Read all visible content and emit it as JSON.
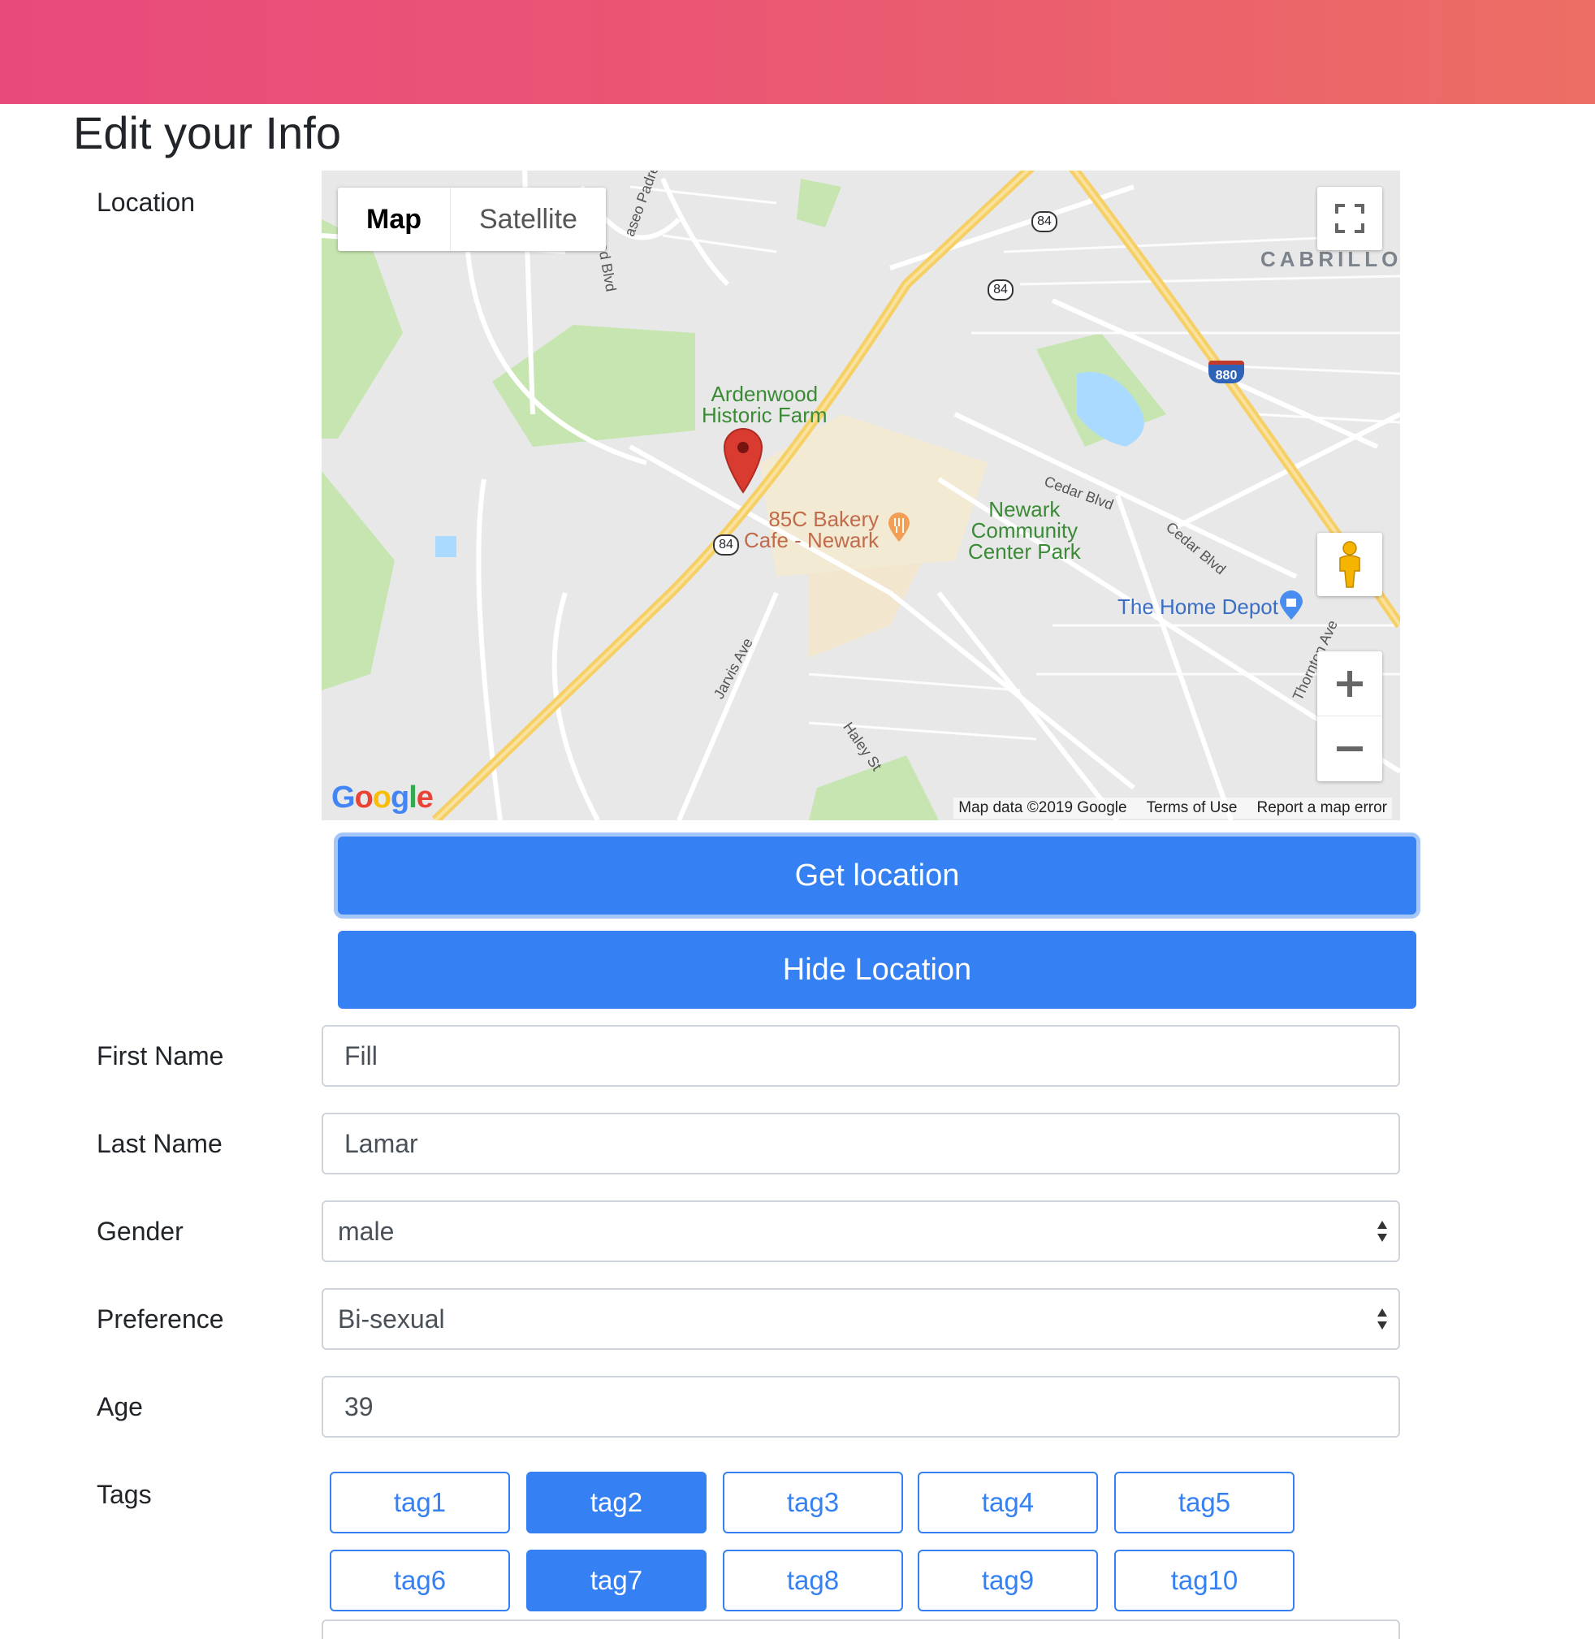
{
  "header": {
    "title": "Edit your Info"
  },
  "location": {
    "label": "Location",
    "map": {
      "type_map": "Map",
      "type_satellite": "Satellite",
      "places": {
        "cabrillo": "CABRILLO",
        "ardenwood": [
          "Ardenwood",
          "Historic Farm"
        ],
        "bakery": [
          "85C Bakery",
          "Cafe - Newark"
        ],
        "park": [
          "Newark",
          "Community",
          "Center Park"
        ],
        "home_depot": "The Home Depot",
        "cedar_blvd_1": "Cedar Blvd",
        "cedar_blvd_2": "Cedar Blvd",
        "jarvis": "Jarvis Ave",
        "haley": "Haley St",
        "paseo": "aseo Padre",
        "ardenwood_blvd": "nwood Blvd",
        "thornton": "Thornton Ave"
      },
      "shields": {
        "hwy84": "84",
        "i880": "880"
      },
      "logo": "Google",
      "footer": {
        "data": "Map data ©2019 Google",
        "terms": "Terms of Use",
        "report": "Report a map error"
      }
    },
    "get_button": "Get location",
    "hide_button": "Hide Location"
  },
  "form": {
    "first_name": {
      "label": "First Name",
      "value": "Fill"
    },
    "last_name": {
      "label": "Last Name",
      "value": "Lamar"
    },
    "gender": {
      "label": "Gender",
      "value": "male"
    },
    "preference": {
      "label": "Preference",
      "value": "Bi-sexual"
    },
    "age": {
      "label": "Age",
      "value": "39"
    },
    "tags": {
      "label": "Tags",
      "items": [
        {
          "label": "tag1",
          "selected": false
        },
        {
          "label": "tag2",
          "selected": true
        },
        {
          "label": "tag3",
          "selected": false
        },
        {
          "label": "tag4",
          "selected": false
        },
        {
          "label": "tag5",
          "selected": false
        },
        {
          "label": "tag6",
          "selected": false
        },
        {
          "label": "tag7",
          "selected": true
        },
        {
          "label": "tag8",
          "selected": false
        },
        {
          "label": "tag9",
          "selected": false
        },
        {
          "label": "tag10",
          "selected": false
        }
      ]
    }
  },
  "colors": {
    "accent": "#3580f2",
    "header_start": "#e94a7c",
    "header_end": "#ec6e64",
    "marker": "#d93b30"
  },
  "icons": {
    "fullscreen": "fullscreen-icon",
    "pegman": "pegman-icon",
    "zoom_in": "plus-icon",
    "zoom_out": "minus-icon",
    "marker": "map-marker-icon"
  }
}
